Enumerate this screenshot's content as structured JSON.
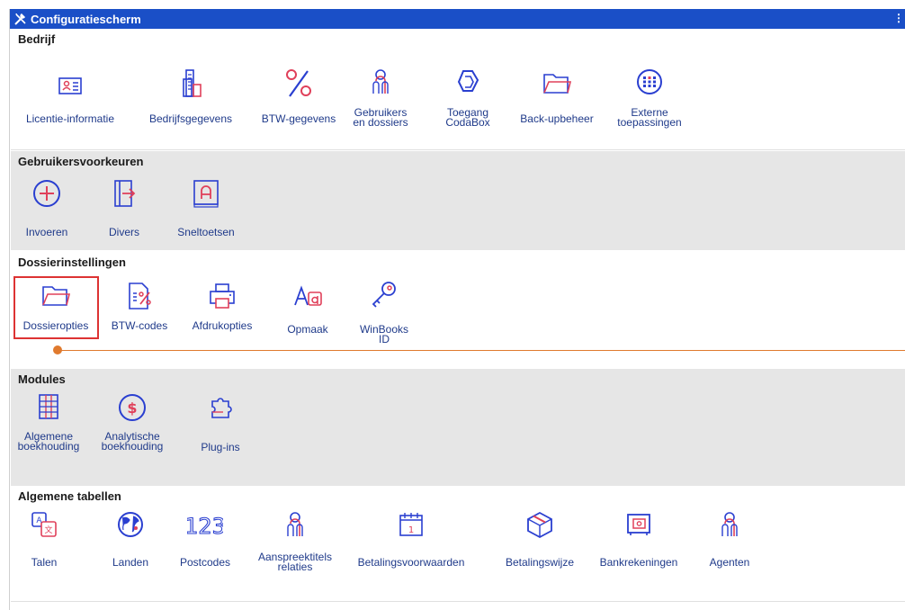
{
  "window": {
    "title": "Configuratiescherm"
  },
  "sections": {
    "bedrijf": {
      "title": "Bedrijf",
      "items": [
        {
          "label": "Licentie-informatie",
          "icon": "id-card-icon"
        },
        {
          "label": "Bedrijfsgegevens",
          "icon": "building-icon"
        },
        {
          "label": "BTW-gegevens",
          "icon": "percent-icon"
        },
        {
          "label": "Gebruikers\nen dossiers",
          "icon": "users-icon"
        },
        {
          "label": "Toegang\nCodaBox",
          "icon": "codabox-icon"
        },
        {
          "label": "Back-upbeheer",
          "icon": "folder-icon"
        },
        {
          "label": "Externe\ntoepassingen",
          "icon": "apps-icon"
        }
      ]
    },
    "gebruikersvoorkeuren": {
      "title": "Gebruikersvoorkeuren",
      "items": [
        {
          "label": "Invoeren",
          "icon": "plus-circle-icon"
        },
        {
          "label": "Divers",
          "icon": "export-doc-icon"
        },
        {
          "label": "Sneltoetsen",
          "icon": "shortcut-key-icon"
        }
      ]
    },
    "dossierinstellingen": {
      "title": "Dossierinstellingen",
      "items": [
        {
          "label": "Dossieropties",
          "icon": "folder-icon"
        },
        {
          "label": "BTW-codes",
          "icon": "vat-doc-icon"
        },
        {
          "label": "Afdrukopties",
          "icon": "printer-icon"
        },
        {
          "label": "Opmaak",
          "icon": "font-format-icon"
        },
        {
          "label": "WinBooks\nID",
          "icon": "key-icon"
        }
      ],
      "selected": "Dossieropties"
    },
    "modules": {
      "title": "Modules",
      "items": [
        {
          "label": "Algemene\nboekhouding",
          "icon": "ledger-icon"
        },
        {
          "label": "Analytische\nboekhouding",
          "icon": "dollar-circle-icon"
        },
        {
          "label": "Plug-ins",
          "icon": "puzzle-icon"
        }
      ]
    },
    "algemene_tabellen": {
      "title": "Algemene tabellen",
      "items": [
        {
          "label": "Talen",
          "icon": "language-icon"
        },
        {
          "label": "Landen",
          "icon": "globe-icon"
        },
        {
          "label": "Postcodes",
          "icon": "numbers-icon"
        },
        {
          "label": "Aanspreektitels\nrelaties",
          "icon": "person-icon"
        },
        {
          "label": "Betalingsvoorwaarden",
          "icon": "calendar-icon"
        },
        {
          "label": "Betalingswijze",
          "icon": "payment-box-icon"
        },
        {
          "label": "Bankrekeningen",
          "icon": "safe-icon"
        },
        {
          "label": "Agenten",
          "icon": "person-icon"
        }
      ]
    }
  },
  "colors": {
    "titlebar": "#1a4fc7",
    "accent_red": "#e0405a",
    "accent_blue": "#2a3fd0",
    "section_grey": "#e6e6e6",
    "selection": "#dd3333",
    "progress": "#e07a2e"
  }
}
